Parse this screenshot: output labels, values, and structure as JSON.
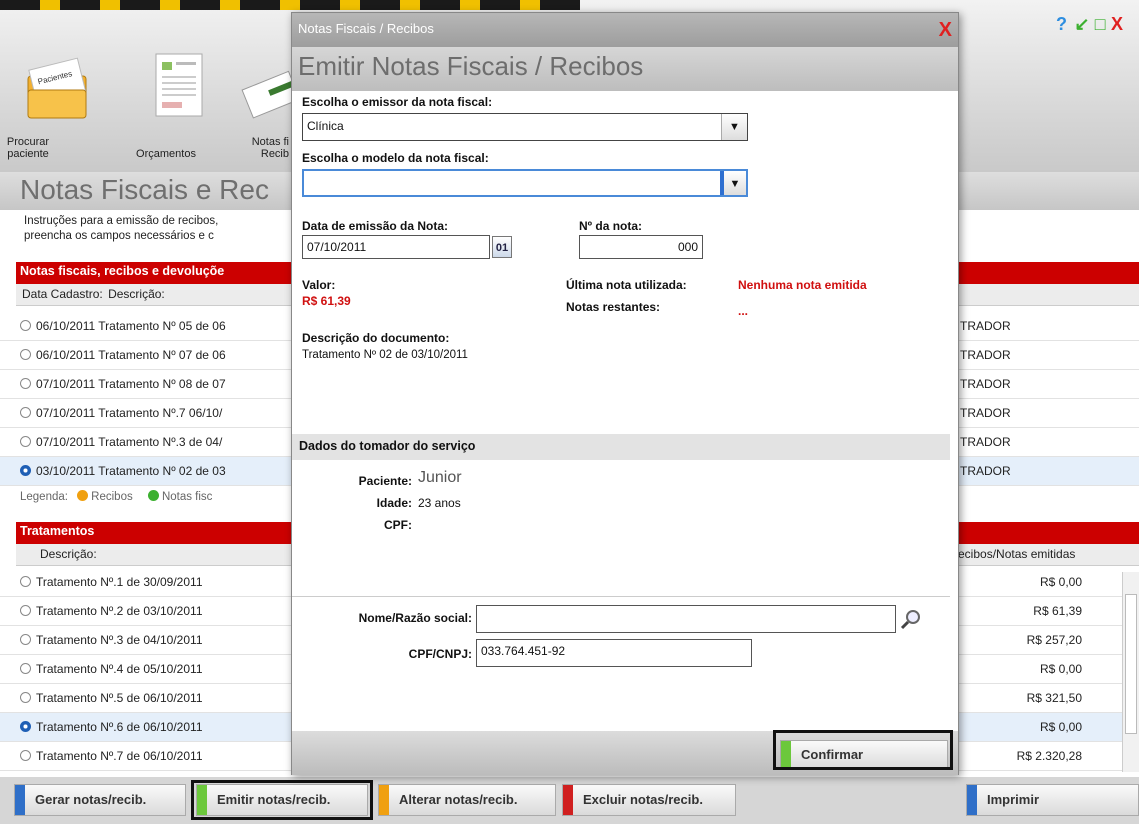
{
  "toolbar": {
    "buttons": [
      {
        "label_line1": "Procurar",
        "label_line2": "paciente",
        "icon": "folder-patients-icon",
        "folder_text": "Pacientes"
      },
      {
        "label_line1": "",
        "label_line2": "Orçamentos",
        "icon": "budget-document-icon"
      },
      {
        "label_line1": "Notas fi",
        "label_line2": "Recib",
        "icon": "invoice-icon"
      }
    ],
    "window_controls": [
      "?",
      "↙",
      "□",
      "X"
    ]
  },
  "page": {
    "title": "Notas Fiscais e Rec",
    "instructions_line1": "Instruções para a emissão de recibos,",
    "instructions_line2": "preencha os campos necessários e c"
  },
  "invoices": {
    "header": "Notas fiscais, recibos e devoluçõe",
    "col_date": "Data Cadastro:",
    "col_desc": "Descrição:",
    "rows": [
      {
        "date": "06/10/2011",
        "desc": "Tratamento Nº 05 de 06",
        "user": "TRADOR",
        "selected": false
      },
      {
        "date": "06/10/2011",
        "desc": "Tratamento Nº 07 de 06",
        "user": "TRADOR",
        "selected": false
      },
      {
        "date": "07/10/2011",
        "desc": "Tratamento Nº 08 de 07",
        "user": "TRADOR",
        "selected": false
      },
      {
        "date": "07/10/2011",
        "desc": "Tratamento Nº.7 06/10/",
        "user": "TRADOR",
        "selected": false
      },
      {
        "date": "07/10/2011",
        "desc": "Tratamento Nº.3 de 04/",
        "user": "TRADOR",
        "selected": false
      },
      {
        "date": "03/10/2011",
        "desc": "Tratamento Nº 02 de 03",
        "user": "TRADOR",
        "selected": true
      }
    ]
  },
  "legend": {
    "label": "Legenda:",
    "item1": "Recibos",
    "item2": "Notas fisc",
    "color1": "#f0a010",
    "color2": "#3cb030"
  },
  "treatments": {
    "header": "Tratamentos",
    "col_desc": "Descrição:",
    "col_amount": "ecibos/Notas emitidas",
    "rows": [
      {
        "desc": "Tratamento Nº.1 de 30/09/2011",
        "amount": "R$ 0,00",
        "selected": false
      },
      {
        "desc": "Tratamento Nº.2 de 03/10/2011",
        "amount": "R$ 61,39",
        "selected": false
      },
      {
        "desc": "Tratamento Nº.3 de 04/10/2011",
        "amount": "R$ 257,20",
        "selected": false
      },
      {
        "desc": "Tratamento Nº.4 de 05/10/2011",
        "amount": "R$ 0,00",
        "selected": false
      },
      {
        "desc": "Tratamento Nº.5 de 06/10/2011",
        "amount": "R$ 321,50",
        "selected": false
      },
      {
        "desc": "Tratamento Nº.6 de 06/10/2011",
        "amount": "R$ 0,00",
        "selected": true
      },
      {
        "desc": "Tratamento Nº.7 de 06/10/2011",
        "amount": "R$ 2.320,28",
        "selected": false
      }
    ]
  },
  "bottom_buttons": {
    "gerar": "Gerar notas/recib.",
    "emitir": "Emitir notas/recib.",
    "alterar": "Alterar notas/recib.",
    "excluir": "Excluir notas/recib.",
    "imprimir": "Imprimir",
    "colors": {
      "gerar": "#2f6fc8",
      "emitir": "#6cc83c",
      "alterar": "#f0a010",
      "excluir": "#d02020",
      "imprimir": "#2f6fc8"
    }
  },
  "modal": {
    "title": "Notas Fiscais / Recibos",
    "close": "X",
    "heading": "Emitir Notas Fiscais / Recibos",
    "emitter_label": "Escolha o emissor da nota fiscal:",
    "emitter_value": "Clínica",
    "model_label": "Escolha o modelo da nota fiscal:",
    "model_value": "",
    "date_label": "Data de emissão da Nota:",
    "date_value": "07/10/2011",
    "calendar_label": "01",
    "number_label": "Nº da nota:",
    "number_value": "000",
    "valor_label": "Valor:",
    "valor_value": "R$ 61,39",
    "last_label": "Última nota utilizada:",
    "last_value": "Nenhuma nota emitida",
    "remaining_label": "Notas restantes:",
    "remaining_value": "...",
    "desc_label": "Descrição do documento:",
    "desc_value": "Tratamento Nº 02 de 03/10/2011",
    "taker_section": "Dados do tomador do serviço",
    "patient_label": "Paciente:",
    "patient_value": "Junior",
    "age_label": "Idade:",
    "age_value": "23 anos",
    "cpf_label": "CPF:",
    "cpf_value": "",
    "name_label": "Nome/Razão social:",
    "name_value": "",
    "cpfcnpj_label": "CPF/CNPJ:",
    "cpfcnpj_value": "033.764.451-92",
    "confirm": "Confirmar"
  }
}
